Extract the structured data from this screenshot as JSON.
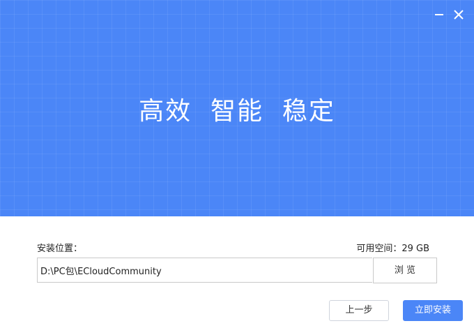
{
  "banner": {
    "slogan": "高效  智能  稳定"
  },
  "window_controls": {
    "minimize_icon": "minimize-icon",
    "close_icon": "close-icon"
  },
  "install": {
    "location_label": "安装位置：",
    "available_space_label": "可用空间：29 GB",
    "path_value": "D:\\PC包\\ECloudCommunity",
    "browse_label": "浏 览"
  },
  "footer": {
    "prev_label": "上一步",
    "install_label": "立即安装"
  },
  "colors": {
    "accent": "#4b86f7"
  }
}
